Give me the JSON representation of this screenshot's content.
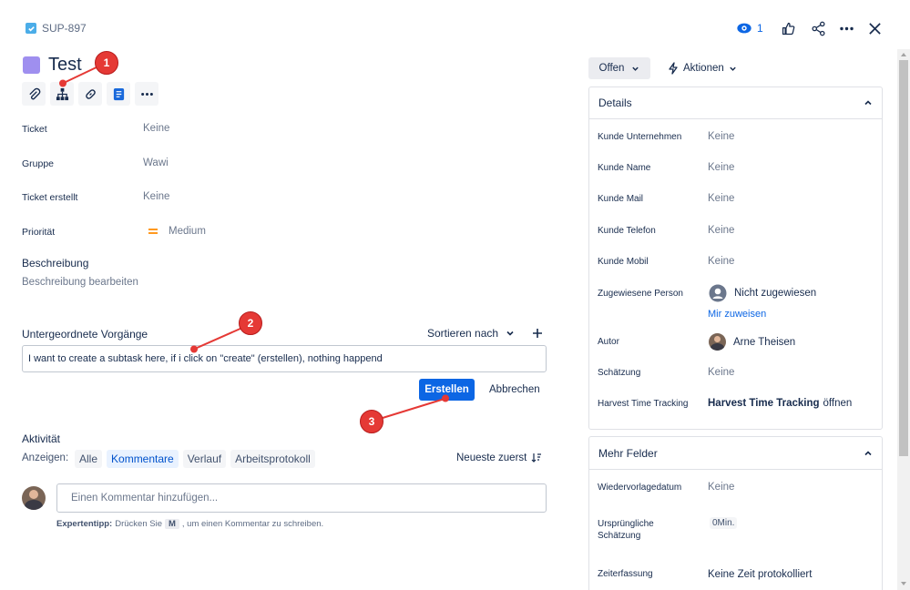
{
  "header": {
    "issue_key": "SUP-897",
    "watch_count": "1"
  },
  "issue": {
    "title": "Test"
  },
  "fields": [
    {
      "label": "Ticket",
      "value": "Keine"
    },
    {
      "label": "Gruppe",
      "value": "Wawi"
    },
    {
      "label": "Ticket erstellt",
      "value": "Keine"
    },
    {
      "label": "Priorität",
      "value": "Medium"
    }
  ],
  "description": {
    "heading": "Beschreibung",
    "placeholder": "Beschreibung bearbeiten"
  },
  "subtasks": {
    "heading": "Untergeordnete Vorgänge",
    "sort_label": "Sortieren nach",
    "input_value": "I want to create a subtask here, if i click on \"create\" (erstellen), nothing happend",
    "create_label": "Erstellen",
    "cancel_label": "Abbrechen"
  },
  "activity": {
    "heading": "Aktivität",
    "show_label": "Anzeigen:",
    "filters": [
      "Alle",
      "Kommentare",
      "Verlauf",
      "Arbeitsprotokoll"
    ],
    "sort_label": "Neueste zuerst",
    "comment_placeholder": "Einen Kommentar hinzufügen...",
    "tip_bold": "Expertentipp:",
    "tip_pre": "Drücken Sie",
    "tip_key": "M",
    "tip_post": ", um einen Kommentar zu schreiben."
  },
  "status": {
    "status_label": "Offen",
    "actions_label": "Aktionen"
  },
  "details": {
    "heading": "Details",
    "rows": [
      {
        "label": "Kunde Unternehmen",
        "value": "Keine"
      },
      {
        "label": "Kunde Name",
        "value": "Keine"
      },
      {
        "label": "Kunde Mail",
        "value": "Keine"
      },
      {
        "label": "Kunde Telefon",
        "value": "Keine"
      },
      {
        "label": "Kunde Mobil",
        "value": "Keine"
      }
    ],
    "assignee_label": "Zugewiesene Person",
    "assignee_value": "Nicht zugewiesen",
    "assign_me": "Mir zuweisen",
    "author_label": "Autor",
    "author_value": "Arne Theisen",
    "estimate_label": "Schätzung",
    "estimate_value": "Keine",
    "harvest_label": "Harvest Time Tracking",
    "harvest_bold": "Harvest Time Tracking",
    "harvest_link": "öffnen"
  },
  "more_fields": {
    "heading": "Mehr Felder",
    "resubmission_label": "Wiedervorlagedatum",
    "resubmission_value": "Keine",
    "original_label_1": "Ursprüngliche",
    "original_label_2": "Schätzung",
    "original_value": "0Min.",
    "time_label": "Zeiterfassung",
    "time_value": "Keine Zeit protokolliert"
  },
  "callouts": [
    "1",
    "2",
    "3"
  ],
  "colors": {
    "accent": "#0c66e4",
    "issue_type": "#9f8fef",
    "priority": "#ff991f",
    "callout": "#e53935"
  }
}
